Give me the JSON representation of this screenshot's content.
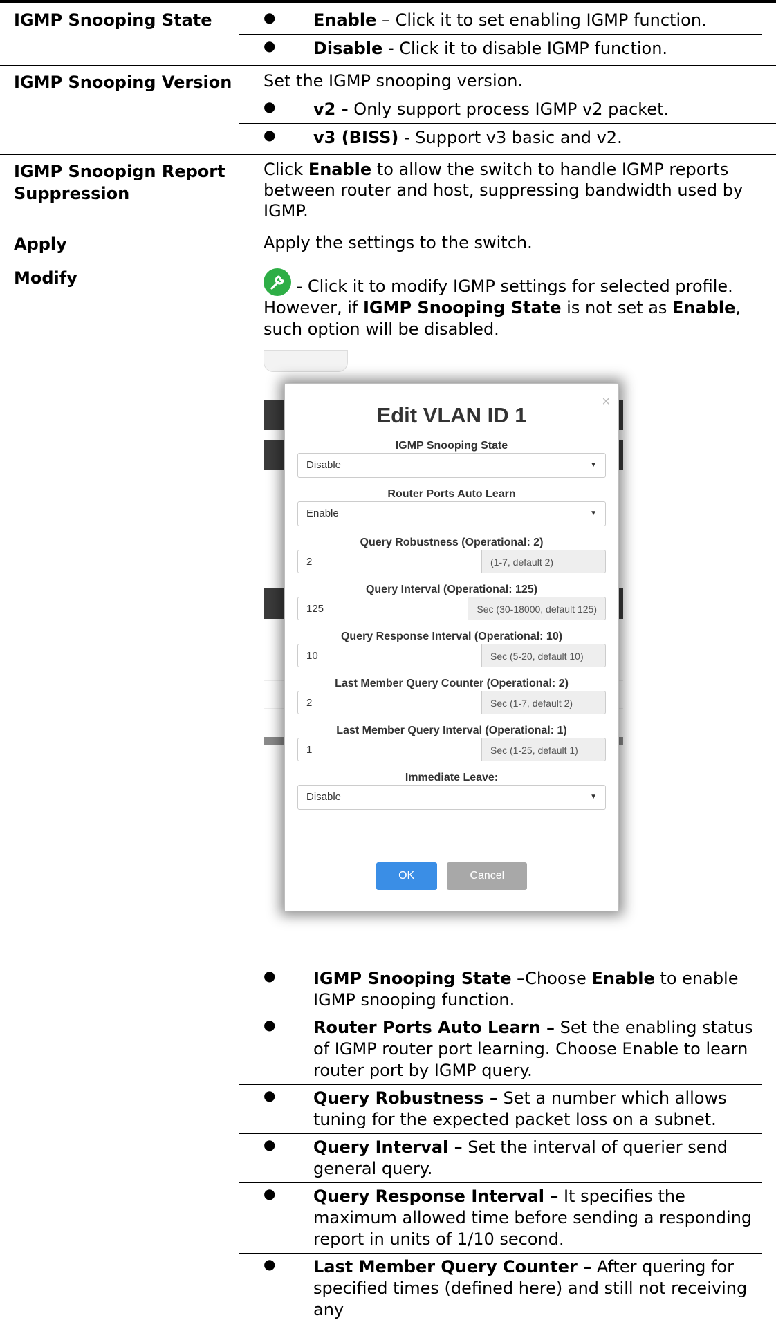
{
  "rows": [
    {
      "label": "IGMP Snooping State",
      "items": [
        {
          "term": "Enable",
          "text": " – Click it to set enabling IGMP function."
        },
        {
          "term": "Disable",
          "text": " - Click it to disable IGMP function."
        }
      ]
    },
    {
      "label": "IGMP Snooping Version",
      "intro": "Set the IGMP snooping version.",
      "items": [
        {
          "term": "v2 -",
          "text": " Only support process IGMP v2 packet."
        },
        {
          "term": "v3 (BISS)",
          "text": " - Support v3 basic and v2."
        }
      ]
    },
    {
      "label": "IGMP Snoopign Report Suppression",
      "text_pre": "Click ",
      "text_term": "Enable",
      "text_post": " to allow the switch to handle IGMP reports between router and host, suppressing bandwidth used by IGMP."
    },
    {
      "label": "Apply",
      "text": "Apply the settings to the switch."
    },
    {
      "label": "Modify",
      "p1": " - Click it to modify IGMP settings for selected profile. However, if ",
      "p1_term1": "IGMP Snooping State",
      "p1_mid": " is not set as ",
      "p1_term2": "Enable",
      "p1_end": ", such option will be disabled.",
      "dialog": {
        "title": "Edit VLAN ID 1",
        "close": "×",
        "fields": {
          "state_label": "IGMP Snooping State",
          "state_value": "Disable",
          "router_label": "Router Ports Auto Learn",
          "router_value": "Enable",
          "robust_label": "Query Robustness (Operational: 2)",
          "robust_value": "2",
          "robust_hint": "(1-7, default 2)",
          "qint_label": "Query Interval (Operational: 125)",
          "qint_value": "125",
          "qint_hint": "Sec (30-18000, default 125)",
          "qresp_label": "Query Response Interval (Operational: 10)",
          "qresp_value": "10",
          "qresp_hint": "Sec (5-20, default 10)",
          "lmqc_label": "Last Member Query Counter (Operational: 2)",
          "lmqc_value": "2",
          "lmqc_hint": "Sec (1-7, default 2)",
          "lmqi_label": "Last Member Query Interval (Operational: 1)",
          "lmqi_value": "1",
          "lmqi_hint": "Sec (1-25, default 1)",
          "leave_label": "Immediate Leave:",
          "leave_value": "Disable"
        },
        "ok": "OK",
        "cancel": "Cancel"
      },
      "items": [
        {
          "term": "IGMP Snooping State",
          "text": " –Choose ",
          "term2": "Enable",
          "text2": " to enable IGMP snooping function."
        },
        {
          "term": "Router Ports Auto Learn –",
          "text": " Set the enabling status of IGMP router port learning. Choose Enable to learn router port by IGMP query."
        },
        {
          "term": "Query Robustness –",
          "text": " Set a number which allows tuning for the expected packet loss on a subnet."
        },
        {
          "term": "Query Interval –",
          "text": " Set the interval of querier send general query."
        },
        {
          "term": "Query Response Interval –",
          "text": " It specifies the maximum allowed time before sending a responding report in units of 1/10 second."
        },
        {
          "term": "Last Member Query Counter –",
          "text": " After quering for specified times (defined here) and still not receiving any"
        }
      ]
    }
  ]
}
